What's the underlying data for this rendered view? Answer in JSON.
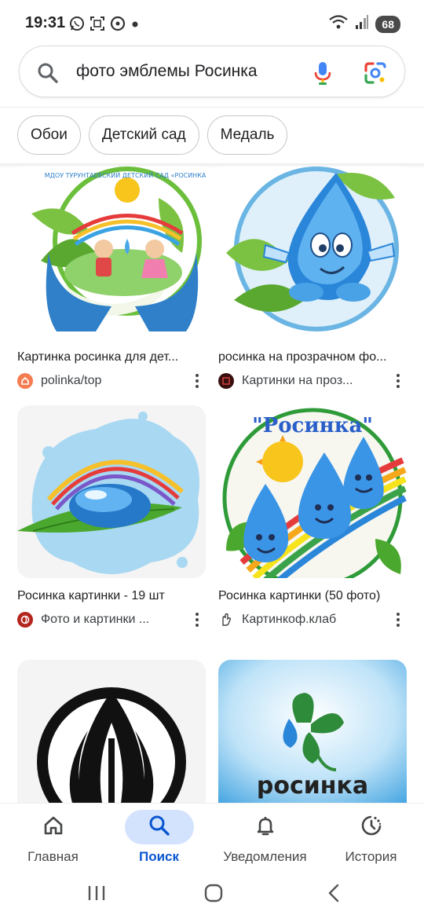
{
  "status_bar": {
    "time": "19:31",
    "left_icons": [
      "whatsapp-icon",
      "screenshot-icon",
      "messenger-icon",
      "dot-icon"
    ],
    "right_icons": [
      "wifi-icon",
      "signal-icon"
    ],
    "battery": "68"
  },
  "search": {
    "query": "фото эмблемы Росинка",
    "icons": [
      "search-icon",
      "mic-icon",
      "google-lens-icon"
    ]
  },
  "chips": [
    {
      "label": "Обои"
    },
    {
      "label": "Детский сад"
    },
    {
      "label": "Медаль"
    }
  ],
  "results": [
    {
      "caption": "Картинка росинка для дет...",
      "source": "polinka/top",
      "favicon": "house-favicon",
      "favicon_color": "#f47c50",
      "image": "kindergarten-emblem-children-hands-leaves",
      "image_text": "МДОУ ТУРУНТАЕВСКИЙ ДЕТСКИЙ САД «РОСИНКА»"
    },
    {
      "caption": "росинка на прозрачном фо...",
      "source": "Картинки на проз...",
      "favicon": "dark-square-favicon",
      "favicon_color": "#3a0f0f",
      "image": "water-drop-character-with-leaves"
    },
    {
      "caption": "Росинка картинки - 19 шт",
      "source": "Фото и картинки ...",
      "favicon": "swirl-favicon",
      "favicon_color": "#b3261e",
      "image": "water-drop-on-leaf-rainbow-splash"
    },
    {
      "caption": "Росинка картинки (50 фото)",
      "source": "Картинкоф.клаб",
      "favicon": "hand-favicon",
      "favicon_color": "#444444",
      "image": "three-drops-sun-rainbow-emblem",
      "image_text": "\"Росинка\""
    },
    {
      "caption": "",
      "source": "",
      "image": "black-flame-circle-logo"
    },
    {
      "caption": "",
      "source": "",
      "image": "clover-drop-logo",
      "image_text": "росинка"
    }
  ],
  "bottom_nav": [
    {
      "label": "Главная",
      "icon": "home-icon",
      "active": false
    },
    {
      "label": "Поиск",
      "icon": "search-icon",
      "active": true
    },
    {
      "label": "Уведомления",
      "icon": "bell-icon",
      "active": false
    },
    {
      "label": "История",
      "icon": "history-icon",
      "active": false
    }
  ],
  "system_nav": [
    "recents-button",
    "home-button",
    "back-button"
  ],
  "colors": {
    "accent": "#0b57d0",
    "active_pill": "#d3e3fd",
    "chip_border": "#c4c7c5"
  }
}
